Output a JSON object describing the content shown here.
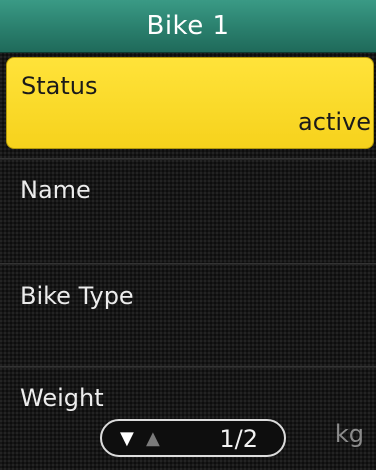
{
  "header": {
    "title": "Bike 1"
  },
  "items": [
    {
      "label": "Status",
      "value": "active"
    },
    {
      "label": "Name",
      "value": ""
    },
    {
      "label": "Bike Type",
      "value": ""
    },
    {
      "label": "Weight",
      "value": "",
      "unit": "kg"
    }
  ],
  "pager": {
    "down_icon": "▼",
    "up_icon": "▲",
    "page": "1/2"
  },
  "colors": {
    "title_bar": "#2a7f6d",
    "selected_row": "#f6d21c",
    "background": "#161616"
  }
}
